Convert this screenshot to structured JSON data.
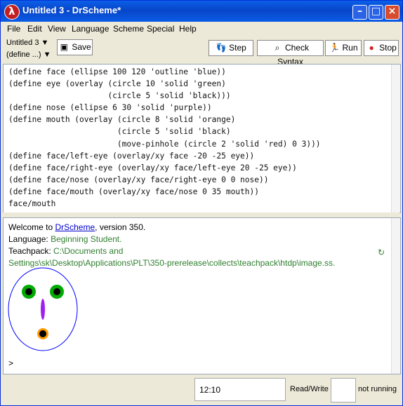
{
  "window": {
    "title": "Untitled 3 - DrScheme*"
  },
  "menus": [
    "File",
    "Edit",
    "View",
    "Language",
    "Scheme",
    "Special",
    "Help"
  ],
  "toolbar": {
    "file_selector": "Untitled 3 ▼",
    "define_selector": "(define ...) ▼",
    "save_label": "Save",
    "step_label": "Step",
    "check_label": "Check Syntax",
    "run_label": "Run",
    "stop_label": "Stop"
  },
  "editor": {
    "code": "(define face (ellipse 100 120 'outline 'blue))\n(define eye (overlay (circle 10 'solid 'green)\n                     (circle 5 'solid 'black)))\n(define nose (ellipse 6 30 'solid 'purple))\n(define mouth (overlay (circle 8 'solid 'orange)\n                       (circle 5 'solid 'black)\n                       (move-pinhole (circle 2 'solid 'red) 0 3)))\n(define face/left-eye (overlay/xy face -20 -25 eye))\n(define face/right-eye (overlay/xy face/left-eye 20 -25 eye))\n(define face/nose (overlay/xy face/right-eye 0 0 nose))\n(define face/mouth (overlay/xy face/nose 0 35 mouth))\nface/mouth"
  },
  "interactions": {
    "welcome_prefix": "Welcome to ",
    "welcome_link": "DrScheme",
    "welcome_suffix": ", version 350.",
    "language_label": "Language: ",
    "language_value": "Beginning Student.",
    "teachpack_label": "Teachpack: ",
    "teachpack_path_1": "C:\\Documents and",
    "teachpack_path_2": "Settings\\sk\\Desktop\\Applications\\PLT\\350-prerelease\\collects\\teachpack\\htdp\\image.ss.",
    "prompt": ">"
  },
  "status": {
    "clock": "12:10",
    "read_write": "Read/Write",
    "running": "not running"
  },
  "colors": {
    "face": "#0000FF",
    "eye": "#00AA00",
    "nose": "#A020F0",
    "mouth": "#FF9900"
  }
}
